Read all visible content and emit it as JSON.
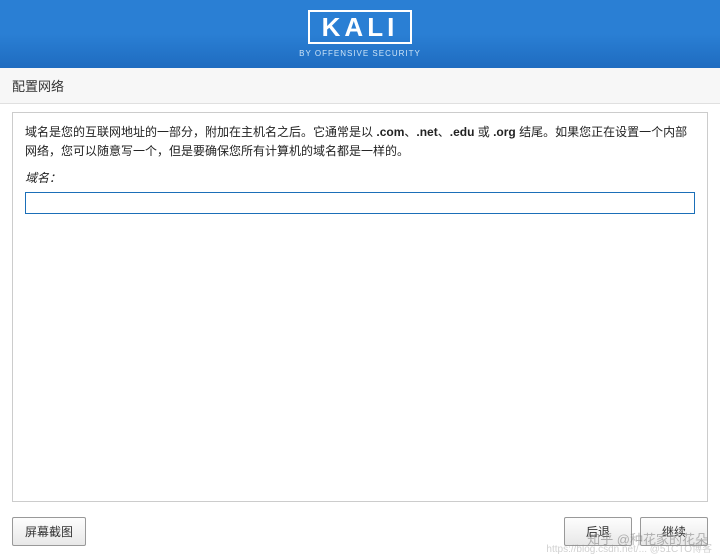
{
  "banner": {
    "logo": "KALI",
    "subtitle": "BY OFFENSIVE SECURITY"
  },
  "section_title": "配置网络",
  "description_parts": {
    "p1": "域名是您的互联网地址的一部分，附加在主机名之后。它通常是以",
    "ext1": ".com",
    "sep1": "、",
    "ext2": ".net",
    "sep2": "、",
    "ext3": ".edu",
    "sep3": " 或 ",
    "ext4": ".org",
    "p2": " 结尾。如果您正在设置一个内部网络，您可以随意写一个，但是要确保您所有计算机的域名都是一样的。"
  },
  "field_label": "域名：",
  "domain_value": "",
  "buttons": {
    "screenshot": "屏幕截图",
    "back": "后退",
    "continue": "继续"
  },
  "watermark_main": "知乎 @种花家的花朵",
  "watermark_sub": "https://blog.csdn.net/... @51CTO博客"
}
